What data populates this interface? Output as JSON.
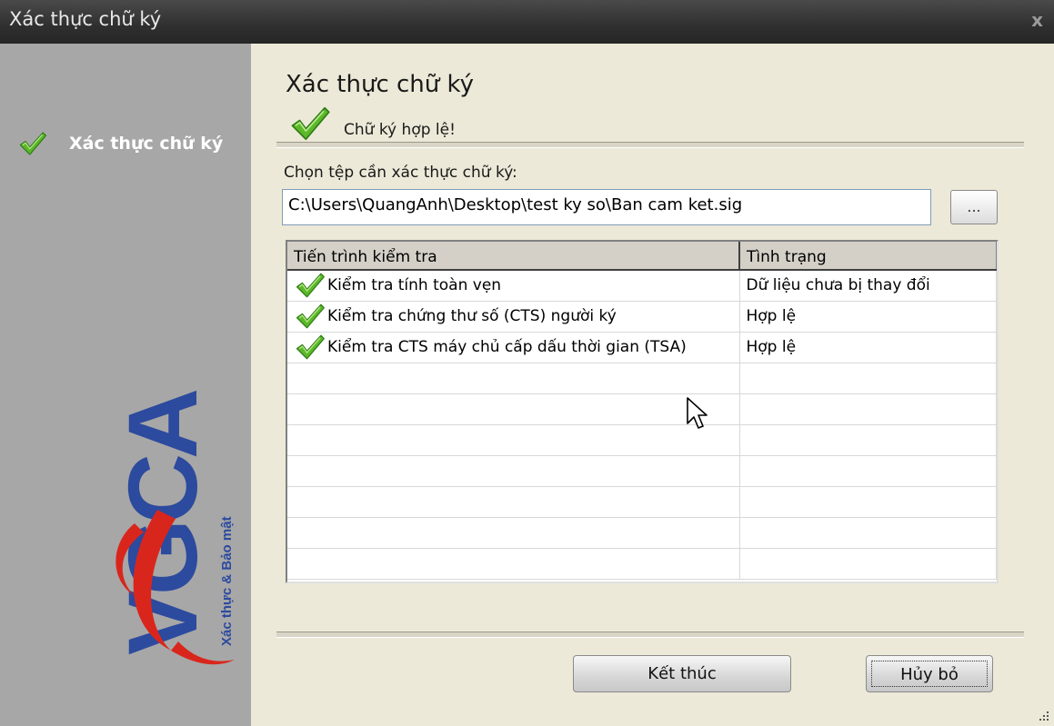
{
  "window": {
    "title": "Xác thực chữ ký",
    "close_glyph": "x"
  },
  "sidebar": {
    "items": [
      {
        "label": "Xác thực chữ ký",
        "icon": "checkmark-icon",
        "active": true
      }
    ],
    "logo": {
      "brand": "VGCA",
      "tagline": "Xác thực & Bảo mật"
    }
  },
  "main": {
    "heading": "Xác thực chữ ký",
    "status_text": "Chữ ký hợp lệ!",
    "file_label": "Chọn tệp cần xác thực chữ ký:",
    "file_path": "C:\\Users\\QuangAnh\\Desktop\\test ky so\\Ban cam ket.sig",
    "browse_label": "...",
    "table": {
      "columns": [
        "Tiến trình kiểm tra",
        "Tình trạng"
      ],
      "rows": [
        {
          "check": "Kiểm tra tính toàn vẹn",
          "status": "Dữ liệu chưa bị thay đổi"
        },
        {
          "check": "Kiểm tra chứng thư số (CTS) người ký",
          "status": "Hợp lệ"
        },
        {
          "check": "Kiểm tra CTS máy chủ cấp dấu thời gian (TSA)",
          "status": "Hợp lệ"
        }
      ]
    }
  },
  "footer": {
    "finish_label": "Kết thúc",
    "cancel_label": "Hủy bỏ"
  },
  "colors": {
    "titlebar": "#2f2f2f",
    "sidebar": "#a7a7a7",
    "dialog": "#ece9d8",
    "logo_blue": "#2c4a9e",
    "logo_red": "#d9261c",
    "check_green": "#4caf1f"
  }
}
